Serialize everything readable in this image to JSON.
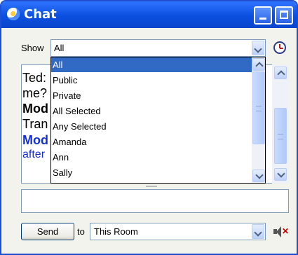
{
  "window": {
    "title": "Chat"
  },
  "show": {
    "label": "Show",
    "selected": "All"
  },
  "show_options": [
    "All",
    "Public",
    "Private",
    "All Selected",
    "Any Selected",
    "Amanda",
    "Ann",
    "Sally"
  ],
  "chat_log": [
    {
      "text": "Ted:",
      "style": "normal"
    },
    {
      "text": "me?",
      "style": "normal"
    },
    {
      "text": "Mod",
      "style": "bold"
    },
    {
      "text": "Tran",
      "style": "normal"
    },
    {
      "text": "Mod",
      "style": "blue-bold"
    },
    {
      "text": "after",
      "style": "blue"
    }
  ],
  "send": {
    "label": "Send"
  },
  "to": {
    "label": "to",
    "selected": "This Room"
  },
  "icons": {
    "app": "chat-icon",
    "minimize": "minimize-icon",
    "maximize": "maximize-icon",
    "history": "clock-icon",
    "mute": "speaker-muted-icon"
  },
  "colors": {
    "titlebar": "#0b4fe0",
    "highlight": "#316ac5",
    "moderator_text": "#1530d8"
  }
}
